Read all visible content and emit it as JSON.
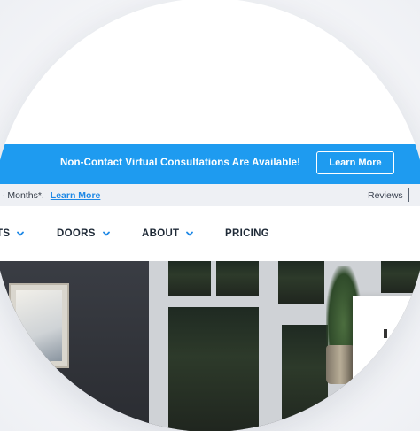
{
  "banner": {
    "text": "Non-Contact Virtual Consultations Are Available!",
    "button_label": "Learn More",
    "color": "#1e9bf0"
  },
  "subbar": {
    "text": "· Months*.",
    "link_label": "Learn More",
    "right_label": "Reviews"
  },
  "nav": {
    "items": [
      {
        "label": "TS",
        "has_dropdown": true
      },
      {
        "label": "DOORS",
        "has_dropdown": true
      },
      {
        "label": "ABOUT",
        "has_dropdown": true
      },
      {
        "label": "PRICING",
        "has_dropdown": false
      }
    ]
  },
  "icons": {
    "dropdown": "chevron-down-icon"
  },
  "colors": {
    "accent": "#1e9bf0",
    "link": "#1e88e5",
    "nav_text": "#1f2a37"
  }
}
